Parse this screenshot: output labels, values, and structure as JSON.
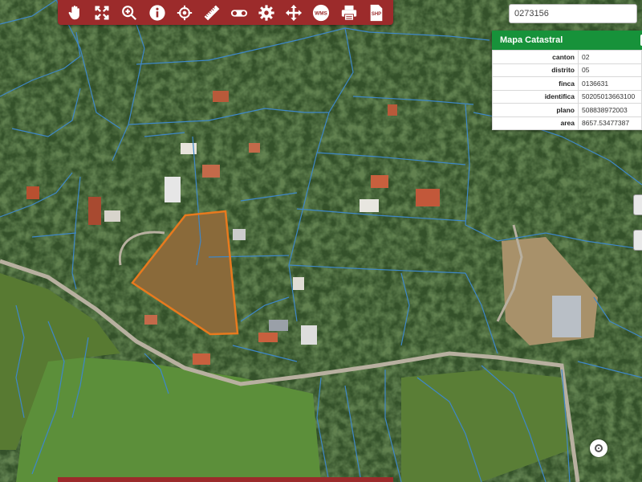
{
  "toolbar": {
    "tools": [
      {
        "name": "pan-hand-icon"
      },
      {
        "name": "full-extent-icon"
      },
      {
        "name": "zoom-in-icon"
      },
      {
        "name": "info-icon"
      },
      {
        "name": "crosshair-icon"
      },
      {
        "name": "ruler-icon"
      },
      {
        "name": "binoculars-icon"
      },
      {
        "name": "settings-gear-icon"
      },
      {
        "name": "move-arrows-icon"
      },
      {
        "name": "wms-icon",
        "label": "WMS"
      },
      {
        "name": "print-icon"
      },
      {
        "name": "shp-icon",
        "label": "SHP"
      }
    ],
    "color": "#9c2b2b"
  },
  "search": {
    "value": "0273156"
  },
  "panel": {
    "title": "Mapa Catastral",
    "rows": [
      {
        "key": "canton",
        "value": "02"
      },
      {
        "key": "distrito",
        "value": "05"
      },
      {
        "key": "finca",
        "value": "0136631"
      },
      {
        "key": "identifica",
        "value": "50205013663100"
      },
      {
        "key": "plano",
        "value": "508838972003"
      },
      {
        "key": "area",
        "value": "8657.53477387"
      }
    ],
    "header_color": "#17923a"
  },
  "map": {
    "parcel_line_color": "#3e87c8",
    "highlight_color": "#e87a1e",
    "road_color": "#b8b0a0"
  }
}
